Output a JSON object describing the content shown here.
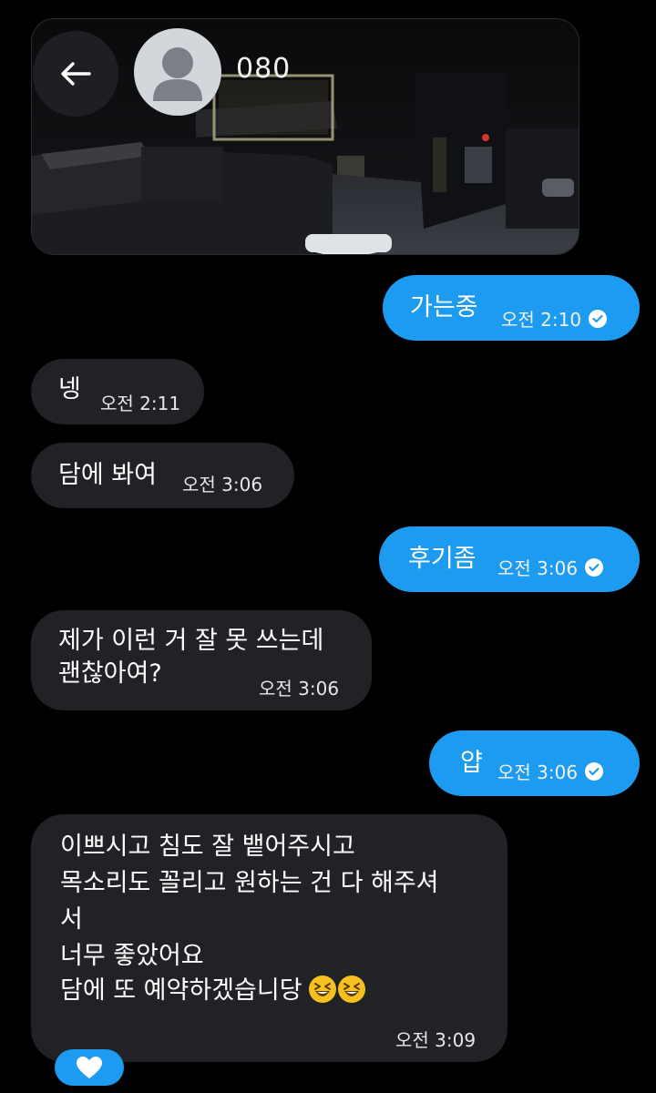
{
  "header": {
    "contact_name": "080",
    "back_icon": "arrow-left-icon",
    "avatar_icon": "default-avatar-icon"
  },
  "messages": [
    {
      "direction": "out",
      "text": "가는중",
      "time": "오전 2:10",
      "read": true
    },
    {
      "direction": "in",
      "text": "넹",
      "time": "오전 2:11"
    },
    {
      "direction": "in",
      "text": "담에 봐여",
      "time": "오전 3:06"
    },
    {
      "direction": "out",
      "text": "후기좀",
      "time": "오전 3:06",
      "read": true
    },
    {
      "direction": "in",
      "lines": [
        "제가 이런 거 잘 못 쓰는데",
        "괜찮아여?"
      ],
      "time": "오전 3:06"
    },
    {
      "direction": "out",
      "text": "얍",
      "time": "오전 3:06",
      "read": true
    },
    {
      "direction": "in",
      "lines": [
        "이쁘시고 침도 잘 뱉어주시고",
        "목소리도 꼴리고 원하는 건 다 해주셔",
        "서",
        "너무 좋았어요",
        "담에 또 예약하겠습니당"
      ],
      "emoji": "grinning-squinting-face-emoji",
      "time": "오전 3:09",
      "reaction": "heart-icon"
    }
  ],
  "colors": {
    "background": "#000000",
    "incoming_bubble": "#212226",
    "outgoing_bubble": "#1d9bf0",
    "text": "#ffffff"
  }
}
